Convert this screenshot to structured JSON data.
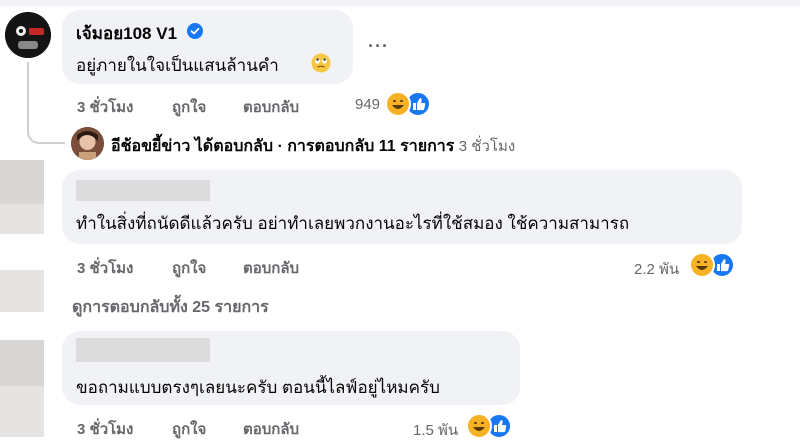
{
  "comments": [
    {
      "author": "เจ้มอย108 V1",
      "verified": true,
      "text": "อยู่ภายในใจเป็นแสนล้านคำ",
      "emoji": "face-with-rolling-eyes",
      "time": "3 ชั่วโมง",
      "like_label": "ถูกใจ",
      "reply_label": "ตอบกลับ",
      "reaction_count": "949",
      "reactions": [
        "haha",
        "like"
      ],
      "more_label": "···"
    },
    {
      "author": "",
      "text": "ทำในสิ่งที่ถนัดดีแล้วครับ อย่าทำเลยพวกงานอะไรที่ใช้สมอง ใช้ความสามารถ",
      "time": "3 ชั่วโมง",
      "like_label": "ถูกใจ",
      "reply_label": "ตอบกลับ",
      "reaction_count": "2.2 พัน",
      "reactions": [
        "haha",
        "like"
      ]
    },
    {
      "author": "",
      "text": "ขอถามแบบตรงๆเลยนะครับ ตอนนี้ไลฟ์อยู่ไหมครับ",
      "time": "3 ชั่วโมง",
      "like_label": "ถูกใจ",
      "reply_label": "ตอบกลับ",
      "reaction_count": "1.5 พัน",
      "reactions": [
        "haha",
        "like"
      ]
    }
  ],
  "reply_summary": {
    "author": "อีช้อขยี้ข่าว",
    "action": "ได้ตอบกลับ",
    "separator": "·",
    "replies": "การตอบกลับ 11 รายการ",
    "time": "3 ชั่วโมง"
  },
  "view_replies": "ดูการตอบกลับทั้ง 25 รายการ",
  "colors": {
    "bubble": "#f0f2f5",
    "secondary_text": "#65676b",
    "like_blue": "#1877f2",
    "haha_yellow": "#f7b125"
  }
}
